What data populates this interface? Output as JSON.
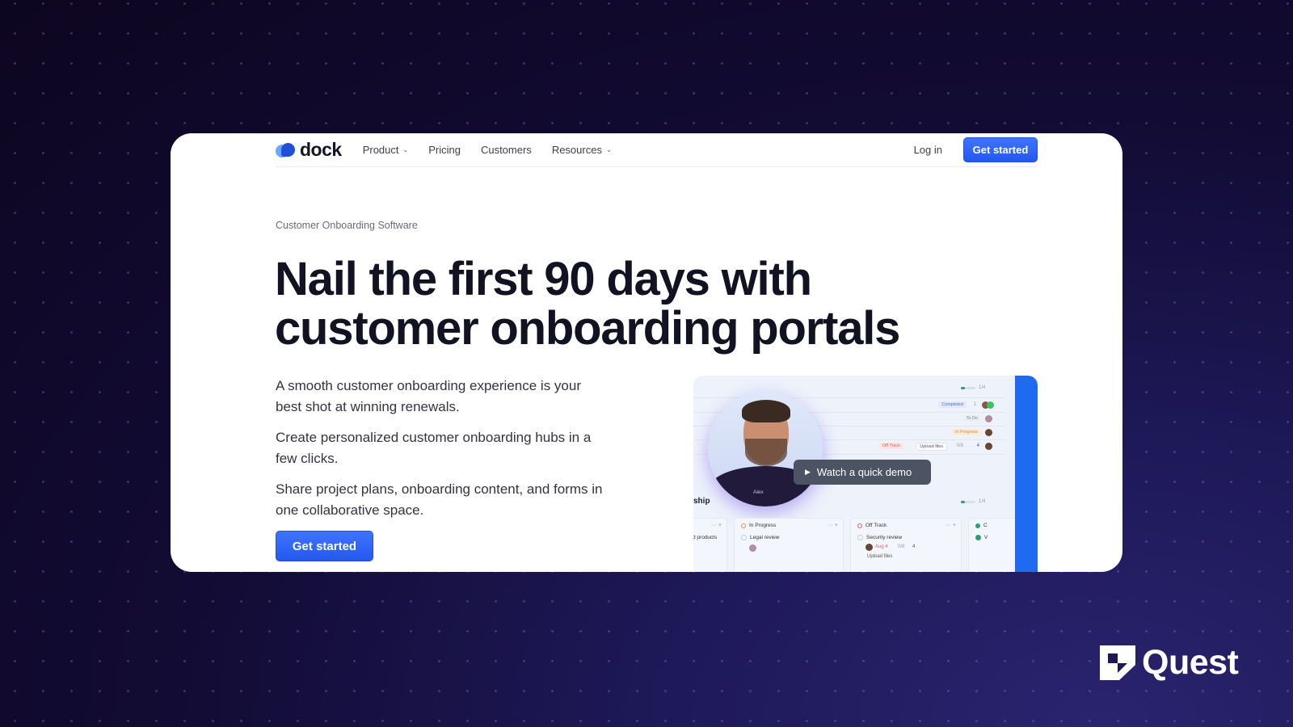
{
  "nav": {
    "brand": "dock",
    "items": [
      {
        "label": "Product",
        "has_dropdown": true
      },
      {
        "label": "Pricing",
        "has_dropdown": false
      },
      {
        "label": "Customers",
        "has_dropdown": false
      },
      {
        "label": "Resources",
        "has_dropdown": true
      }
    ],
    "login": "Log in",
    "cta": "Get started",
    "chevron": "⌄"
  },
  "hero": {
    "eyebrow": "Customer Onboarding Software",
    "headline_line1": "Nail the first 90 days with",
    "headline_line2": "customer onboarding portals",
    "paragraphs": [
      "A smooth customer onboarding experience is your best shot at winning renewals.",
      "Create personalized customer onboarding hubs in a few clicks.",
      "Share project plans, onboarding content, and forms in one collaborative space."
    ],
    "cta": "Get started"
  },
  "preview": {
    "demo_button": "Watch a quick demo",
    "play_icon": "▶",
    "person_name": "Alex",
    "top_progress": "1/4",
    "status_rows": [
      {
        "status": "Completed",
        "comments": "1",
        "color": "#4a6cf0",
        "bg": "#e3e9fd"
      },
      {
        "status": "To Do",
        "comments": "",
        "color": "#7a8092",
        "bg": "#eceef3"
      },
      {
        "status": "In Progress",
        "comments": "",
        "color": "#d48a3c",
        "bg": "#fcebd9"
      },
      {
        "status": "Off Track",
        "upload": "Upload files",
        "count": "0/8",
        "comments": "4",
        "color": "#e0605a",
        "bg": "#fde4e3"
      }
    ],
    "section_title": "ship",
    "section_progress": "1/4",
    "columns": [
      {
        "title": "",
        "task": "d products",
        "ring": "#bbb"
      },
      {
        "title": "In Progress",
        "task": "Legal review",
        "ring": "#e0944c"
      },
      {
        "title": "Off Track",
        "task": "Security review",
        "ring": "#e06060",
        "meta_date": "Aug 4",
        "meta_count": "0/8",
        "meta_comments": "4",
        "upload": "Upload files"
      },
      {
        "title": "C",
        "task": "V",
        "ring": "#2e9c6e"
      }
    ],
    "col_actions": "··· +"
  },
  "watermark": {
    "brand": "Quest"
  },
  "colors": {
    "accent": "#2458f0",
    "background": "#120b33",
    "preview_bar": "#1e6bf2"
  }
}
